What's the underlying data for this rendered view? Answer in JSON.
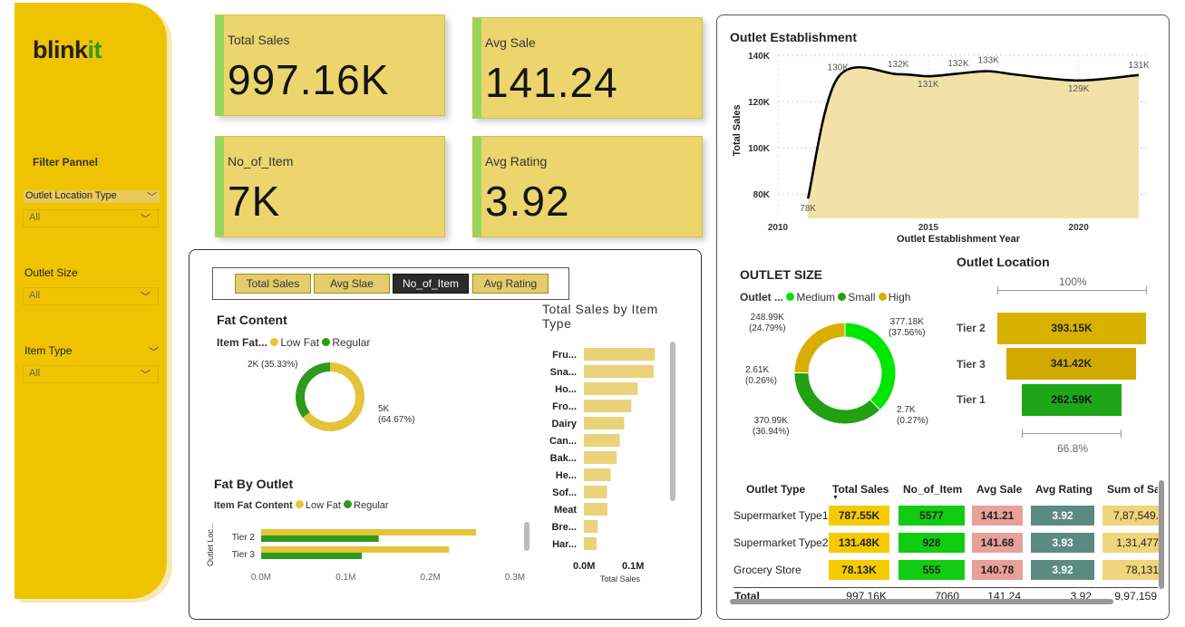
{
  "brand": {
    "name_prefix": "blink",
    "name_suffix": "it",
    "accent": "#2e9a1b",
    "sidebar_color": "#f0c300"
  },
  "filters": {
    "title": "Filter Pannel",
    "outlet_location": {
      "label": "Outlet Location Type",
      "value": "All"
    },
    "outlet_size": {
      "label": "Outlet Size",
      "value": "All"
    },
    "item_type": {
      "label": "Item Type",
      "value": "All"
    }
  },
  "kpis": [
    {
      "label": "Total Sales",
      "value": "997.16K"
    },
    {
      "label": "Avg Sale",
      "value": "141.24"
    },
    {
      "label": "No_of_Item",
      "value": "7K"
    },
    {
      "label": "Avg Rating",
      "value": "3.92"
    }
  ],
  "tabs": [
    "Total Sales",
    "Avg Slae",
    "No_of_Item",
    "Avg Rating"
  ],
  "active_tab": "No_of_Item",
  "fat_content": {
    "title": "Fat Content",
    "legend_title": "Item Fat...",
    "series": [
      {
        "name": "Low Fat",
        "color": "#e5c33a"
      },
      {
        "name": "Regular",
        "color": "#2e9a1b"
      }
    ],
    "labels": {
      "low": "5K",
      "low_pct": "(64.67%)",
      "reg": "2K (35.33%)"
    }
  },
  "fat_by_outlet": {
    "title": "Fat By Outlet",
    "legend_title": "Item Fat Content",
    "yaxis": "Outlet Loc...",
    "ticks": [
      "0.0M",
      "0.1M",
      "0.2M",
      "0.3M"
    ]
  },
  "outlet_establishment": {
    "title": "Outlet Establishment",
    "xlabel": "Outlet Establishment Year",
    "ylabel": "Total Sales",
    "yticks": [
      "140K",
      "120K",
      "100K",
      "80K"
    ],
    "xticks": [
      "2010",
      "2015",
      "2020"
    ]
  },
  "outlet_size": {
    "title": "OUTLET SIZE",
    "legend_title": "Outlet ...",
    "series": [
      {
        "name": "Medium",
        "color": "#00e600"
      },
      {
        "name": "Small",
        "color": "#22a012"
      },
      {
        "name": "High",
        "color": "#d9ae00"
      }
    ],
    "labels": [
      {
        "v": "248.99K",
        "p": "(24.79%)"
      },
      {
        "v": "377.18K",
        "p": "(37.56%)"
      },
      {
        "v": "2.61K",
        "p": "(0.26%)"
      },
      {
        "v": "2.7K",
        "p": "(0.27%)"
      },
      {
        "v": "370.99K",
        "p": "(36.94%)"
      }
    ]
  },
  "outlet_location": {
    "title": "Outlet Location",
    "top_pct": "100%",
    "bottom_pct": "66.8%",
    "tiers": [
      {
        "label": "Tier 2",
        "value": "393.15K"
      },
      {
        "label": "Tier 3",
        "value": "341.42K"
      },
      {
        "label": "Tier 1",
        "value": "262.59K"
      }
    ]
  },
  "item_type_chart": {
    "title": "Total Sales by Item Type",
    "xlabel": "Total Sales",
    "ticks": [
      "0.0M",
      "0.1M"
    ]
  },
  "table": {
    "headers": [
      "Outlet Type",
      "Total Sales",
      "No_of_Item",
      "Avg Sale",
      "Avg Rating",
      "Sum of Sa"
    ],
    "rows": [
      {
        "type": "Supermarket Type1",
        "sales": "787.55K",
        "items": "5577",
        "avg": "141.21",
        "rating": "3.92",
        "sum": "7,87,549."
      },
      {
        "type": "Supermarket Type2",
        "sales": "131.48K",
        "items": "928",
        "avg": "141.68",
        "rating": "3.93",
        "sum": "1,31,477"
      },
      {
        "type": "Grocery Store",
        "sales": "78.13K",
        "items": "555",
        "avg": "140.78",
        "rating": "3.92",
        "sum": "78,131"
      }
    ],
    "total": {
      "label": "Total",
      "sales": "997.16K",
      "items": "7060",
      "avg": "141.24",
      "rating": "3.92",
      "sum": "9,97,159"
    }
  },
  "chart_data": [
    {
      "type": "line",
      "title": "Outlet Establishment",
      "xlabel": "Outlet Establishment Year",
      "ylabel": "Total Sales",
      "x": [
        2011,
        2012,
        2014,
        2015,
        2016,
        2017,
        2018,
        2020,
        2022
      ],
      "values": [
        78.13,
        130.48,
        131.81,
        130.94,
        132.11,
        133.1,
        131.48,
        129.1,
        131.47
      ],
      "data_labels": [
        "78K",
        "130K",
        "132K",
        "131K",
        "132K",
        "133K",
        "",
        "129K",
        "131K"
      ],
      "ylim": [
        75,
        140
      ],
      "xlim": [
        2010,
        2022
      ]
    },
    {
      "type": "pie",
      "title": "Fat Content",
      "categories": [
        "Low Fat",
        "Regular"
      ],
      "values": [
        64.67,
        35.33
      ]
    },
    {
      "type": "pie",
      "title": "OUTLET SIZE",
      "categories": [
        "Medium",
        "Small",
        "High"
      ],
      "values": [
        37.83,
        37.2,
        24.79
      ]
    },
    {
      "type": "bar",
      "title": "Total Sales by Item Type",
      "xlabel": "Total Sales",
      "categories": [
        "Fru...",
        "Sna...",
        "Ho...",
        "Fro...",
        "Dairy",
        "Can...",
        "Bak...",
        "He...",
        "Sof...",
        "Meat",
        "Bre...",
        "Har..."
      ],
      "values": [
        0.178,
        0.175,
        0.135,
        0.119,
        0.101,
        0.09,
        0.082,
        0.067,
        0.058,
        0.059,
        0.035,
        0.032
      ],
      "xlim": [
        0,
        0.2
      ]
    },
    {
      "type": "bar",
      "title": "Fat By Outlet",
      "categories": [
        "Tier 2",
        "Tier 3"
      ],
      "series": [
        {
          "name": "Low Fat",
          "values": [
            0.254,
            0.222
          ]
        },
        {
          "name": "Regular",
          "values": [
            0.139,
            0.119
          ]
        }
      ],
      "xlim": [
        0,
        0.3
      ]
    }
  ]
}
